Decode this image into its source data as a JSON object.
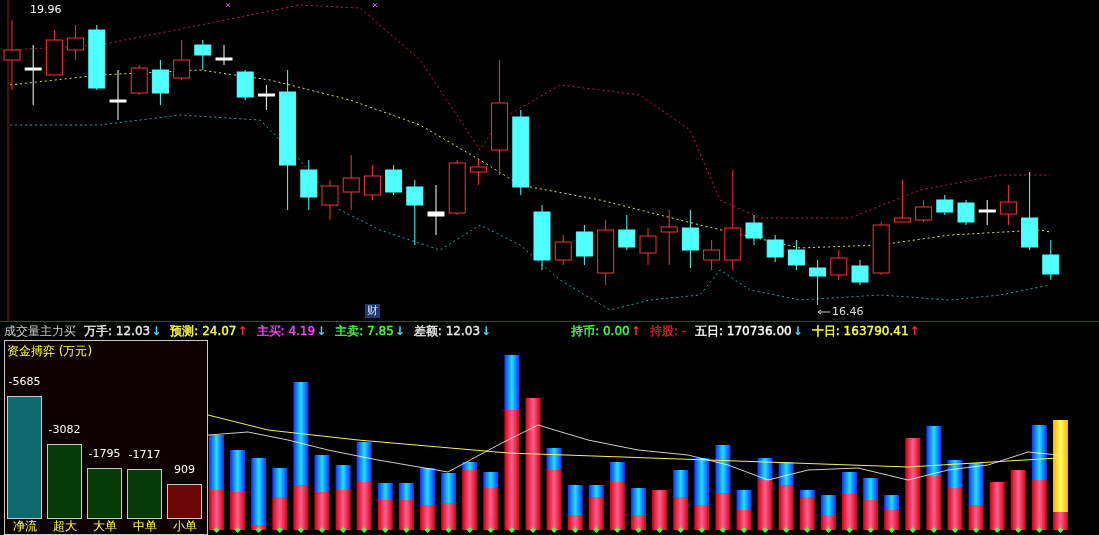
{
  "price_chart": {
    "high_label": "19.96",
    "low_label": "16.46",
    "event_marker": "财"
  },
  "indicator_bar": {
    "title": "成交量主力买",
    "items": [
      {
        "text": "万手: 12.03",
        "arrow": "↓",
        "rising": false,
        "color": "#e8e8e8"
      },
      {
        "text": "预测: 24.07",
        "arrow": "↑",
        "rising": true,
        "color": "#ffff40"
      },
      {
        "text": "主买: 4.19",
        "arrow": "↓",
        "rising": false,
        "color": "#ff40ff"
      },
      {
        "text": "主卖: 7.85",
        "arrow": "↓",
        "rising": false,
        "color": "#40ff40"
      },
      {
        "text": "差额: 12.03",
        "arrow": "↓",
        "rising": false,
        "color": "#e8e8e8"
      },
      {
        "text": "持币: 0.00",
        "arrow": "↑",
        "rising": true,
        "color": "#40ff40"
      },
      {
        "text": "持股: -",
        "color": "#d02020"
      },
      {
        "text": "五日: 170736.00",
        "arrow": "↓",
        "rising": false,
        "color": "#ffffff"
      },
      {
        "text": "十日: 163790.41",
        "arrow": "↑",
        "rising": true,
        "color": "#ffff40"
      }
    ]
  },
  "fund_panel": {
    "title": "资金搏弈 (万元)",
    "bars": [
      {
        "category": "净流",
        "value": "-5685",
        "kind": "net"
      },
      {
        "category": "超大",
        "value": "-3082",
        "kind": "outflow"
      },
      {
        "category": "大单",
        "value": "-1795",
        "kind": "outflow"
      },
      {
        "category": "中单",
        "value": "-1717",
        "kind": "outflow"
      },
      {
        "category": "小单",
        "value": "909",
        "kind": "inflow"
      }
    ]
  }
}
